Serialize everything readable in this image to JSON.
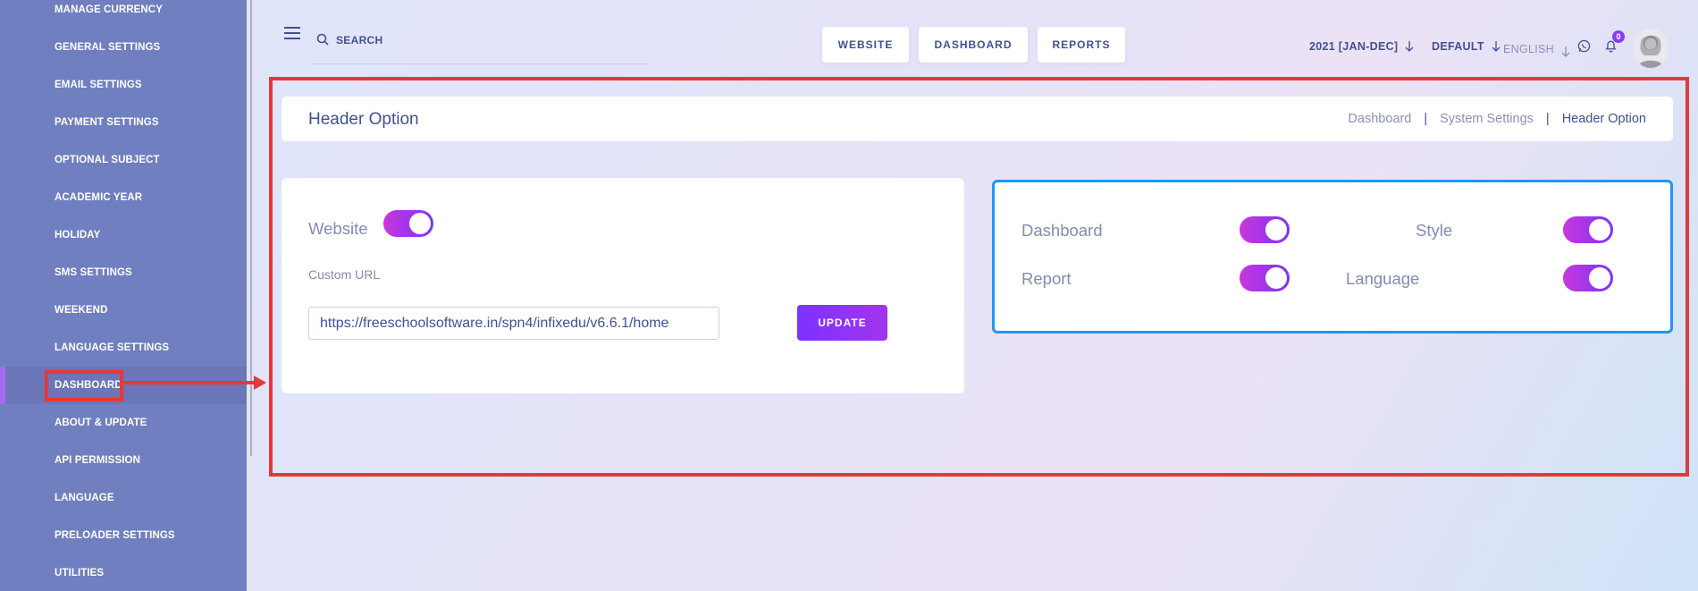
{
  "sidebar": {
    "items": [
      {
        "label": "MANAGE CURRENCY"
      },
      {
        "label": "GENERAL SETTINGS"
      },
      {
        "label": "EMAIL SETTINGS"
      },
      {
        "label": "PAYMENT SETTINGS"
      },
      {
        "label": "OPTIONAL SUBJECT"
      },
      {
        "label": "ACADEMIC YEAR"
      },
      {
        "label": "HOLIDAY"
      },
      {
        "label": "SMS SETTINGS"
      },
      {
        "label": "WEEKEND"
      },
      {
        "label": "LANGUAGE SETTINGS"
      },
      {
        "label": "DASHBOARD",
        "active": true
      },
      {
        "label": "ABOUT & UPDATE"
      },
      {
        "label": "API PERMISSION"
      },
      {
        "label": "LANGUAGE"
      },
      {
        "label": "PRELOADER SETTINGS"
      },
      {
        "label": "UTILITIES"
      }
    ]
  },
  "topbar": {
    "search_placeholder": "SEARCH",
    "buttons": [
      "WEBSITE",
      "DASHBOARD",
      "REPORTS"
    ],
    "session": "2021 [JAN-DEC]",
    "style": "DEFAULT",
    "language": "ENGLISH",
    "notification_count": "0"
  },
  "header": {
    "title": "Header Option",
    "breadcrumb": [
      "Dashboard",
      "System Settings",
      "Header Option"
    ],
    "separator": "|"
  },
  "website_card": {
    "website_label": "Website",
    "website_enabled": true,
    "custom_url_label": "Custom URL",
    "custom_url_value": "https://freeschoolsoftware.in/spn4/infixedu/v6.6.1/home",
    "update_label": "UPDATE"
  },
  "options_card": {
    "dashboard_label": "Dashboard",
    "style_label": "Style",
    "report_label": "Report",
    "language_label": "Language",
    "dashboard_enabled": true,
    "style_enabled": true,
    "report_enabled": true,
    "language_enabled": true
  },
  "colors": {
    "sidebar_bg": "#6f7fc0",
    "accent_start": "#c738d8",
    "accent_end": "#7c32ff",
    "annotation_red": "#e53935",
    "highlight_blue": "#2196f3"
  }
}
